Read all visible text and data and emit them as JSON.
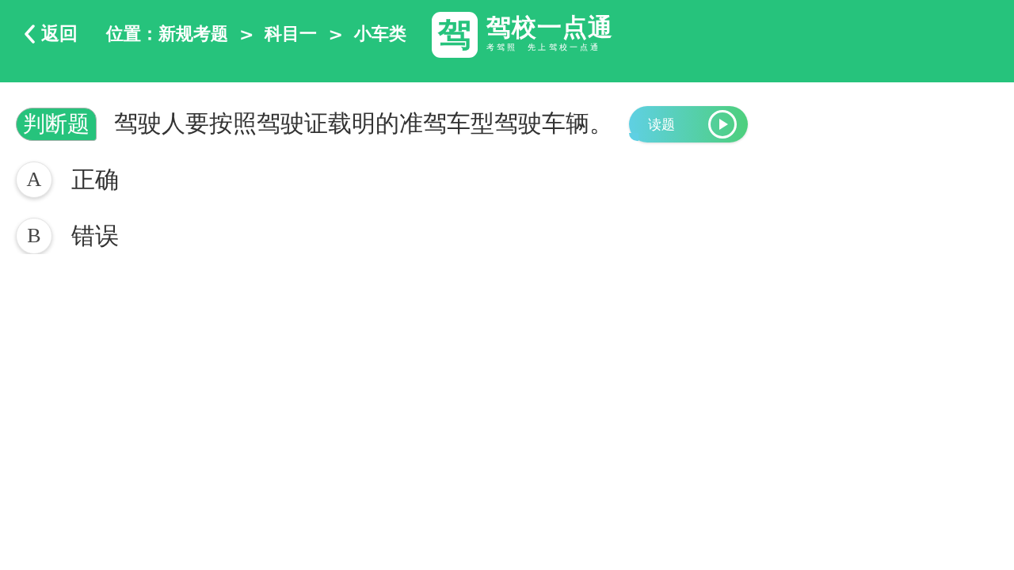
{
  "header": {
    "back": {
      "label": "返回"
    },
    "breadcrumb": {
      "label": "位置：",
      "separator": ">",
      "items": [
        "新规考题",
        "科目一",
        "小车类"
      ]
    },
    "logo": {
      "mark": "驾",
      "title": "驾校一点通",
      "tagline": "考驾照  先上驾校一点通"
    }
  },
  "question": {
    "type": "判断题",
    "text": "驾驶人要按照驾驶证载明的准驾车型驾驶车辆。",
    "read_button": {
      "label": "读题"
    }
  },
  "options": [
    {
      "letter": "A",
      "text": "正确",
      "selected": false
    },
    {
      "letter": "B",
      "text": "错误",
      "selected": false
    }
  ]
}
